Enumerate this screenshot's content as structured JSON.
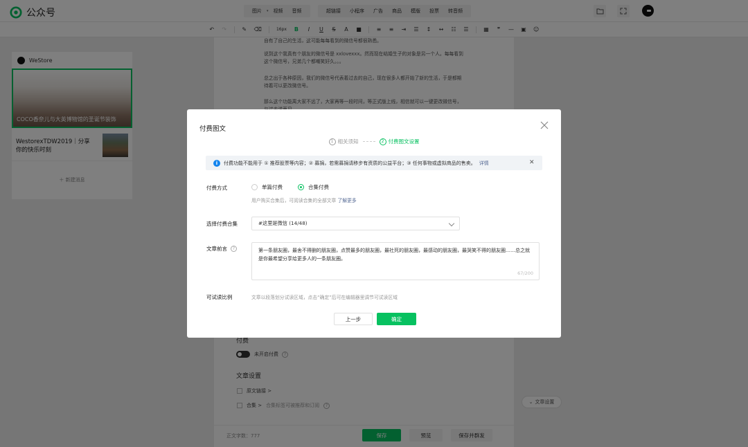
{
  "app": {
    "name": "公众号"
  },
  "insert_menu": {
    "group1": [
      "图片",
      "视频",
      "音频"
    ],
    "group2": [
      "超链接",
      "小程序",
      "广告",
      "商品",
      "模版",
      "投票",
      "转音频"
    ]
  },
  "toolbar": {
    "font_size": "16px"
  },
  "sidebar": {
    "account": "WeStore",
    "articles": [
      {
        "title": "COCO香奈儿与大英博物馆的圣诞节装饰"
      },
      {
        "title": "WestorexTDW2019｜分享你的快乐时刻"
      }
    ],
    "new_message": "新建消息"
  },
  "editor": {
    "paragraphs": [
      "自有了自己的生活，这可能每每看到的微信号都很熟悉。",
      "说到这个我真有个朋友的微信号是 xxlovexxx。然而现在结婚生子的对象是另一个人。每每看到这个微信号，兄弟几个都嘲笑好久。。。",
      "总之出于各种原因，我们的微信号代表着过去的自己，现在很多人都开始了新的生活，于是都期待着可以更改微信号。",
      "那么这个功能离大家不远了，大家再等一段时间，等正式版上线，相信就可以一键更改微信号，与过去说再见。"
    ],
    "pay_section": "付费",
    "pay_toggle_label": "未开启付费",
    "article_settings": "文章设置",
    "original_link": "原文链接 >",
    "collection": "合集 >",
    "collection_hint": "合集标签可被推荐和订阅"
  },
  "bottom": {
    "word_count": "正文字数：777",
    "save": "保存",
    "preview": "预览",
    "save_send": "保存并群发"
  },
  "article_settings_btn": "文章设置",
  "modal": {
    "title": "付费图文",
    "steps": [
      {
        "num": "1",
        "label": "相关须知"
      },
      {
        "num": "2",
        "label": "付费图文设置"
      }
    ],
    "notice": "付费功能不能用于 ① 推荐股票等内容；② 募捐，若需募捐请移步有资质的公益平台；③ 任何事物或虚拟商品的售卖。",
    "notice_link": "详情",
    "pay_mode_label": "付费方式",
    "pay_single": "单篇付费",
    "pay_collection": "合集付费",
    "pay_hint": "用户购买合集后，可阅读合集的全部文章",
    "pay_hint_link": "了解更多",
    "select_label": "选择付费合集",
    "select_value": "#这里是微信 (14/48)",
    "preface_label": "文章前言",
    "preface_text": "第一条朋友圈，最舍不得删的朋友圈，点赞最多的朋友圈，最社死的朋友圈，最感动的朋友圈，最哭笑不得的朋友圈……总之就是你最希望分享给更多人的一条朋友圈。",
    "preface_count": "67/200",
    "trial_label": "可试读比例",
    "trial_hint": "文章以段落划分试读区域，点击“确定”后可在编辑器里调节可试读区域",
    "prev_btn": "上一步",
    "ok_btn": "确定"
  },
  "colors": {
    "brand": "#07c160",
    "info": "#1485ee",
    "link": "#576b95"
  }
}
